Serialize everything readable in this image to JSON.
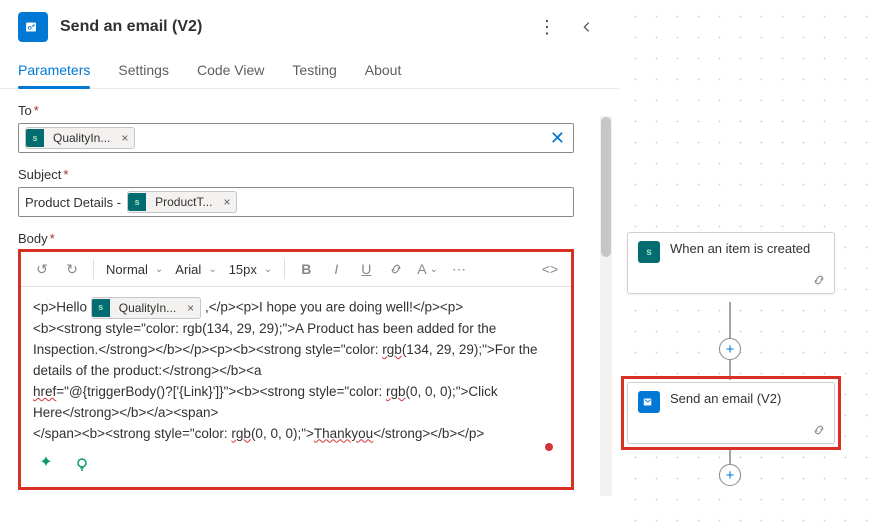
{
  "header": {
    "title": "Send an email (V2)"
  },
  "tabs": {
    "parameters": "Parameters",
    "settings": "Settings",
    "codeview": "Code View",
    "testing": "Testing",
    "about": "About"
  },
  "fields": {
    "to_label": "To",
    "subject_label": "Subject",
    "body_label": "Body",
    "required_mark": "*",
    "to_token": {
      "label": "QualityIn...",
      "icon": "sp"
    },
    "subject_prefix": "Product Details - ",
    "subject_token": {
      "label": "ProductT...",
      "icon": "sp"
    }
  },
  "toolbar": {
    "style": "Normal",
    "font": "Arial",
    "size": "15px"
  },
  "body_content": {
    "l1_pre": "<p>Hello ",
    "l1_token": "QualityIn...",
    "l1_post": " ,</p><p>I hope you are doing well!</p><p>",
    "l2": "<b><strong style=\"color: rgb(134, 29, 29);\">A Product has been added for the Inspection.</strong></b></p><p><b><strong style=\"color: ",
    "l2_wavy": "rgb",
    "l2_end": "(134, 29, 29);\">For the details of the product:</strong></b><a ",
    "l3a": "href",
    "l3": "=\"@{triggerBody()?['{Link}']}\"><b><strong style=\"color: ",
    "l3_wavy": "rgb",
    "l3_end": "(0, 0, 0);\">Click Here</strong></b></a><span>",
    "l4": "</span><b><strong style=\"color: ",
    "l4_wavy": "rgb",
    "l4_mid": "(0, 0, 0);\">",
    "l4_wavy2": "Thankyou",
    "l4_end": "</strong></b></p>"
  },
  "canvas_cards": {
    "trigger": {
      "title": "When an item is created"
    },
    "action": {
      "title": "Send an email (V2)"
    }
  }
}
